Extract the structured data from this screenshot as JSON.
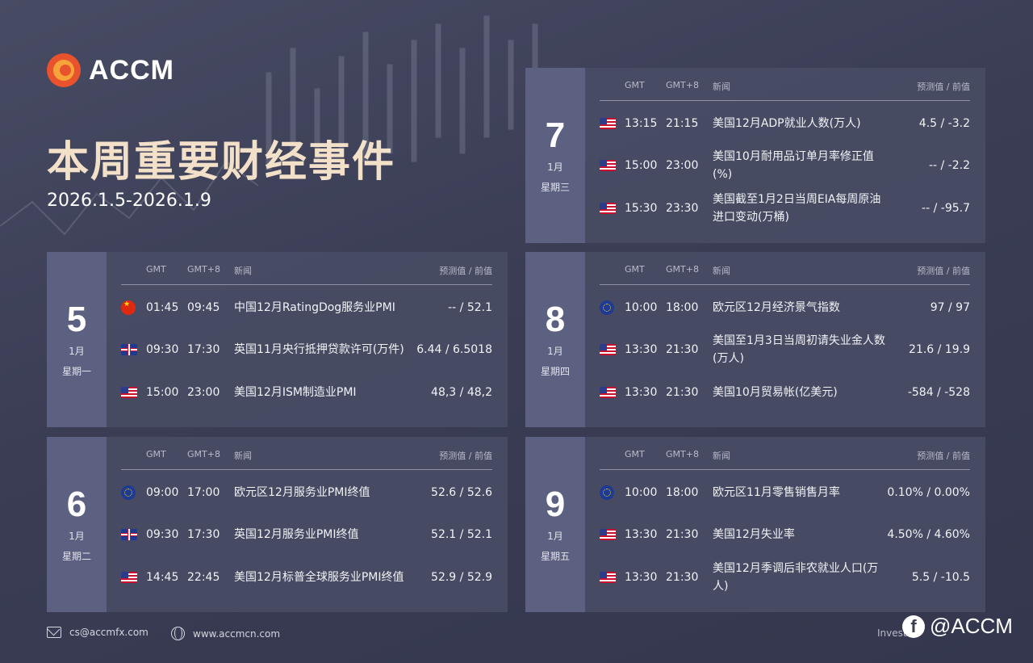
{
  "brand": {
    "name": "ACCM"
  },
  "title": "本周重要财经事件",
  "date_range": "2026.1.5-2026.1.9",
  "header_labels": {
    "gmt": "GMT",
    "gmt8": "GMT+8",
    "news": "新闻",
    "values": "预测值 / 前值"
  },
  "days": [
    {
      "day": "5",
      "month": "1月",
      "weekday": "星期一",
      "events": [
        {
          "flag": "china-flag-icon",
          "gmt": "01:45",
          "gmt8": "09:45",
          "news": "中国12月RatingDog服务业PMI",
          "value": "-- / 52.1"
        },
        {
          "flag": "uk-flag-icon",
          "gmt": "09:30",
          "gmt8": "17:30",
          "news": "英国11月央行抵押贷款许可(万件)",
          "value": "6.44 / 6.5018"
        },
        {
          "flag": "us-flag-icon",
          "gmt": "15:00",
          "gmt8": "23:00",
          "news": "美国12月ISM制造业PMI",
          "value": "48,3 / 48,2"
        }
      ]
    },
    {
      "day": "6",
      "month": "1月",
      "weekday": "星期二",
      "events": [
        {
          "flag": "eu-flag-icon",
          "gmt": "09:00",
          "gmt8": "17:00",
          "news": "欧元区12月服务业PMI终值",
          "value": "52.6 / 52.6"
        },
        {
          "flag": "uk-flag-icon",
          "gmt": "09:30",
          "gmt8": "17:30",
          "news": "英国12月服务业PMI终值",
          "value": "52.1 / 52.1"
        },
        {
          "flag": "us-flag-icon",
          "gmt": "14:45",
          "gmt8": "22:45",
          "news": "美国12月标普全球服务业PMI终值",
          "value": "52.9 / 52.9"
        }
      ]
    },
    {
      "day": "7",
      "month": "1月",
      "weekday": "星期三",
      "events": [
        {
          "flag": "us-flag-icon",
          "gmt": "13:15",
          "gmt8": "21:15",
          "news": "美国12月ADP就业人数(万人)",
          "value": "4.5 / -3.2"
        },
        {
          "flag": "us-flag-icon",
          "gmt": "15:00",
          "gmt8": "23:00",
          "news": "美国10月耐用品订单月率修正值(%)",
          "value": "-- / -2.2"
        },
        {
          "flag": "us-flag-icon",
          "gmt": "15:30",
          "gmt8": "23:30",
          "news": "美国截至1月2日当周EIA每周原油进口变动(万桶)",
          "value": "-- / -95.7"
        }
      ]
    },
    {
      "day": "8",
      "month": "1月",
      "weekday": "星期四",
      "events": [
        {
          "flag": "eu-flag-icon",
          "gmt": "10:00",
          "gmt8": "18:00",
          "news": "欧元区12月经济景气指数",
          "value": "97 / 97"
        },
        {
          "flag": "us-flag-icon",
          "gmt": "13:30",
          "gmt8": "21:30",
          "news": "美国至1月3日当周初请失业金人数(万人)",
          "value": "21.6 / 19.9"
        },
        {
          "flag": "us-flag-icon",
          "gmt": "13:30",
          "gmt8": "21:30",
          "news": "美国10月贸易帐(亿美元)",
          "value": "-584 / -528"
        }
      ]
    },
    {
      "day": "9",
      "month": "1月",
      "weekday": "星期五",
      "events": [
        {
          "flag": "eu-flag-icon",
          "gmt": "10:00",
          "gmt8": "18:00",
          "news": "欧元区11月零售销售月率",
          "value": "0.10% / 0.00%"
        },
        {
          "flag": "us-flag-icon",
          "gmt": "13:30",
          "gmt8": "21:30",
          "news": "美国12月失业率",
          "value": "4.50% / 4.60%"
        },
        {
          "flag": "us-flag-icon",
          "gmt": "13:30",
          "gmt8": "21:30",
          "news": "美国12月季调后非农就业人口(万人)",
          "value": "5.5 / -10.5"
        }
      ]
    }
  ],
  "footer": {
    "email": "cs@accmfx.com",
    "website": "www.accmcn.com",
    "slogan": "Invest"
  },
  "watermark": "@ACCM",
  "colors": {
    "title": "#f3e0c8",
    "logo_red": "#e8522c",
    "logo_orange": "#f6a43a",
    "day_panel": "#5c6182"
  }
}
